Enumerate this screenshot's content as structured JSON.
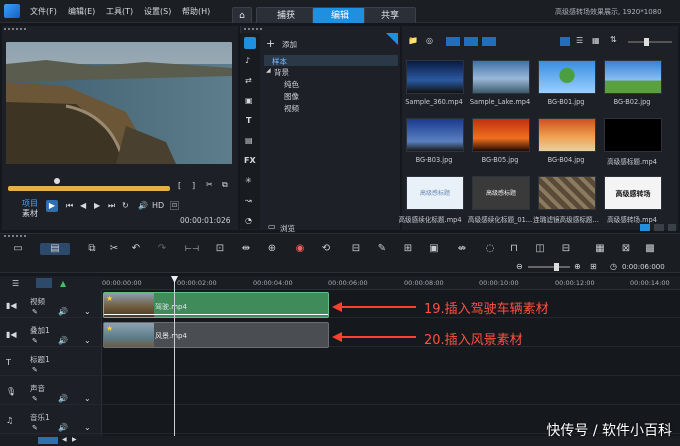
{
  "titlebar": {
    "menus": [
      "文件(F)",
      "编辑(E)",
      "工具(T)",
      "设置(S)",
      "帮助(H)"
    ],
    "tabs": [
      "捕获",
      "编辑",
      "共享"
    ],
    "active_tab": "编辑",
    "window_title": "高级感转场效果展示, 1920*1080"
  },
  "preview": {
    "mode_project": "项目",
    "mode_clip": "素材",
    "hd_label": "HD",
    "timecode": "00:00:01:026"
  },
  "library": {
    "add_label": "添加",
    "tree": [
      "样本",
      "背景",
      "纯色",
      "图像",
      "视频"
    ],
    "browse_label": "浏览",
    "thumbs": [
      {
        "label": "Sample_360.mp4"
      },
      {
        "label": "Sample_Lake.mp4"
      },
      {
        "label": "BG-B01.jpg"
      },
      {
        "label": "BG-B02.jpg"
      },
      {
        "label": "BG-B03.jpg"
      },
      {
        "label": "BG-B05.jpg"
      },
      {
        "label": "BG-B04.jpg"
      },
      {
        "label": "高级感标题.mp4"
      },
      {
        "label": "高级感续化标题.mp4",
        "text": "高级感标题"
      },
      {
        "label": "高级感续化标题_01...",
        "text": "高级感标题"
      },
      {
        "label": "连璐滤镜高级感标题...",
        "text": ""
      },
      {
        "label": "高级感转场.mp4",
        "text": "高级感转场"
      }
    ]
  },
  "timeline": {
    "zoom_time": "0:00:06:000",
    "ruler": [
      "00:00:00:00",
      "00:00:02:00",
      "00:00:04:00",
      "00:00:06:00",
      "00:00:08:00",
      "00:00:10:00",
      "00:00:12:00",
      "00:00:14:00"
    ],
    "tracks": [
      "视频",
      "叠加1",
      "标题1",
      "声音",
      "音乐1"
    ],
    "clip_video": "驾驶.mp4",
    "clip_overlay": "风景.mp4",
    "annotation1": "19.插入驾驶车辆素材",
    "annotation2": "20.插入风景素材"
  },
  "watermark": "快传号 / 软件小百科",
  "colors": {
    "accent": "#1f8fe0",
    "annotation": "#ff5040",
    "clip_video": "#3f8b5a",
    "clip_overlay": "#4a4d52"
  }
}
